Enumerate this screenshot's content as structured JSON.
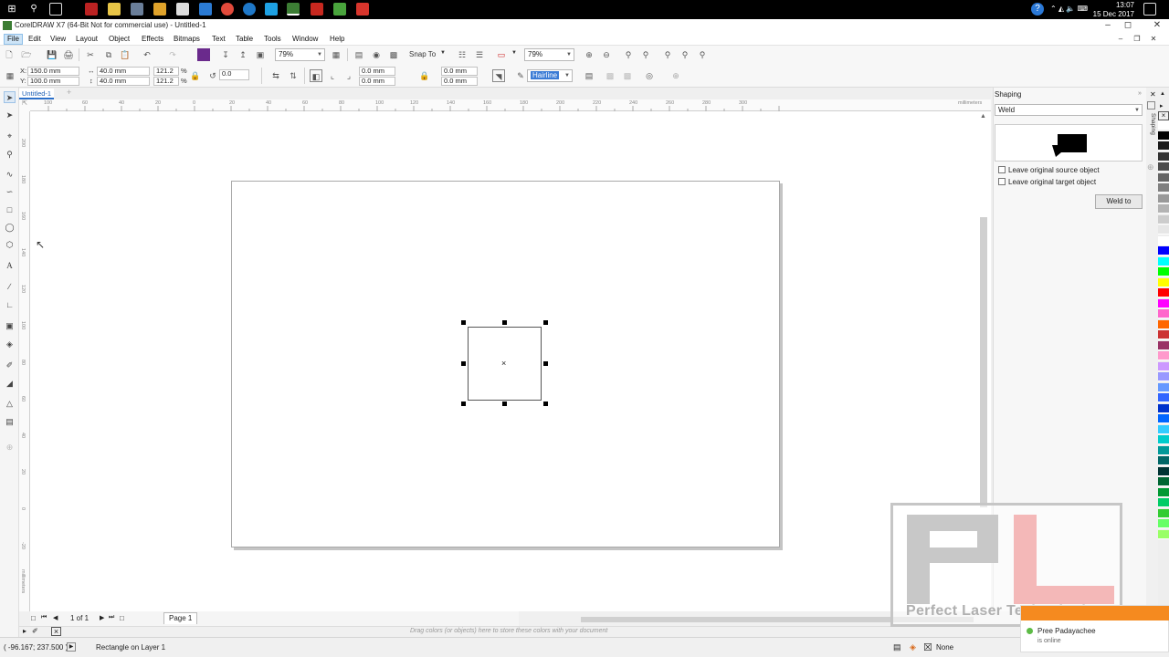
{
  "taskbar": {
    "time": "13:07",
    "date": "15 Dec 2017"
  },
  "app": {
    "title": "CorelDRAW X7 (64-Bit Not for commercial use) - Untitled-1"
  },
  "menu": [
    "File",
    "Edit",
    "View",
    "Layout",
    "Object",
    "Effects",
    "Bitmaps",
    "Text",
    "Table",
    "Tools",
    "Window",
    "Help"
  ],
  "toolbar": {
    "zoom_level": "79%",
    "snap_to": "Snap To",
    "zoom_level2": "79%"
  },
  "propbar": {
    "x_label": "X:",
    "x_value": "150.0 mm",
    "y_label": "Y:",
    "y_value": "100.0 mm",
    "width_value": "40.0 mm",
    "height_value": "40.0 mm",
    "scale_x": "121.2",
    "scale_y": "121.2",
    "percent": "%",
    "rotation": "0.0",
    "corner_tl": "0.0 mm",
    "corner_bl": "0.0 mm",
    "corner_tr": "0.0 mm",
    "corner_br": "0.0 mm",
    "outline_width": "Hairline"
  },
  "document": {
    "tab": "Untitled-1",
    "ruler_units": "millimeters",
    "h_ruler_labels": [
      "100",
      "60",
      "40",
      "20",
      "0",
      "20",
      "40",
      "60",
      "80",
      "100",
      "120",
      "140",
      "160",
      "180",
      "200",
      "220",
      "240",
      "260",
      "280",
      "300"
    ],
    "v_ruler_labels": [
      "200",
      "180",
      "160",
      "140",
      "120",
      "100",
      "80",
      "60",
      "40",
      "20",
      "0",
      "-20"
    ]
  },
  "page_nav": {
    "counter": "1 of 1",
    "page_tab": "Page 1"
  },
  "color_docker": {
    "hint": "Drag colors (or objects) here to store these colors with your document"
  },
  "status": {
    "coords": "( -96.167; 237.500 )",
    "message": "Rectangle on Layer 1",
    "fill": "None"
  },
  "shaping": {
    "title": "Shaping",
    "mode": "Weld",
    "opt_source": "Leave original source object",
    "opt_target": "Leave original target object",
    "weld_button": "Weld to",
    "side_tab": "Shaping"
  },
  "palette": [
    "#ffffff",
    "#000000",
    "#1a1a1a",
    "#333333",
    "#4d4d4d",
    "#666666",
    "#808080",
    "#999999",
    "#b3b3b3",
    "#cccccc",
    "#e6e6e6",
    "#ffffff",
    "#0000ff",
    "#00ffff",
    "#00ff00",
    "#ffff00",
    "#ff0000",
    "#ff00ff",
    "#ff66cc",
    "#ff6600",
    "#cc3333",
    "#993366",
    "#ff99cc",
    "#cc99ff",
    "#9999ff",
    "#6699ff",
    "#3366ff",
    "#0033cc",
    "#0066ff",
    "#33ccff",
    "#00cccc",
    "#009999",
    "#006666",
    "#003333",
    "#006633",
    "#009933",
    "#00cc66",
    "#33cc33",
    "#66ff66",
    "#99ff66"
  ],
  "watermark": {
    "text": "Perfect Laser Technologies"
  },
  "chat": {
    "name": "Pree Padayachee",
    "status": "is online"
  }
}
